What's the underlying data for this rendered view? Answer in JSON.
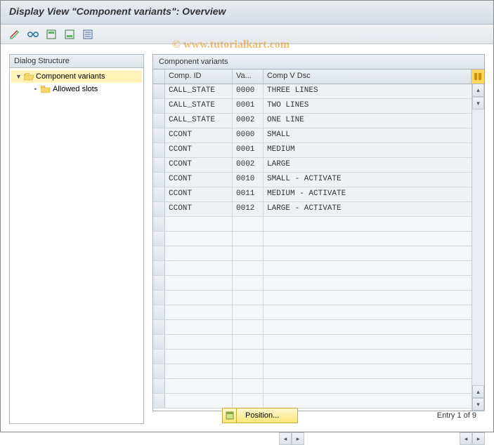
{
  "title": "Display View \"Component variants\": Overview",
  "watermark": "© www.tutorialkart.com",
  "tree": {
    "header": "Dialog Structure",
    "root": "Component variants",
    "child": "Allowed slots"
  },
  "panel": {
    "title": "Component variants",
    "col1": "Comp. ID",
    "col2": "Va...",
    "col3": "Comp V Dsc"
  },
  "chart_data": {
    "type": "table",
    "title": "Component variants",
    "columns": [
      "Comp. ID",
      "Va...",
      "Comp V Dsc"
    ],
    "rows": [
      [
        "CALL_STATE",
        "0000",
        "THREE LINES"
      ],
      [
        "CALL_STATE",
        "0001",
        "TWO LINES"
      ],
      [
        "CALL_STATE",
        "0002",
        "ONE LINE"
      ],
      [
        "CCONT",
        "0000",
        "SMALL"
      ],
      [
        "CCONT",
        "0001",
        "MEDIUM"
      ],
      [
        "CCONT",
        "0002",
        "LARGE"
      ],
      [
        "CCONT",
        "0010",
        "SMALL - ACTIVATE"
      ],
      [
        "CCONT",
        "0011",
        "MEDIUM - ACTIVATE"
      ],
      [
        "CCONT",
        "0012",
        "LARGE - ACTIVATE"
      ]
    ]
  },
  "footer": {
    "position": "Position...",
    "entry": "Entry 1 of 9"
  }
}
